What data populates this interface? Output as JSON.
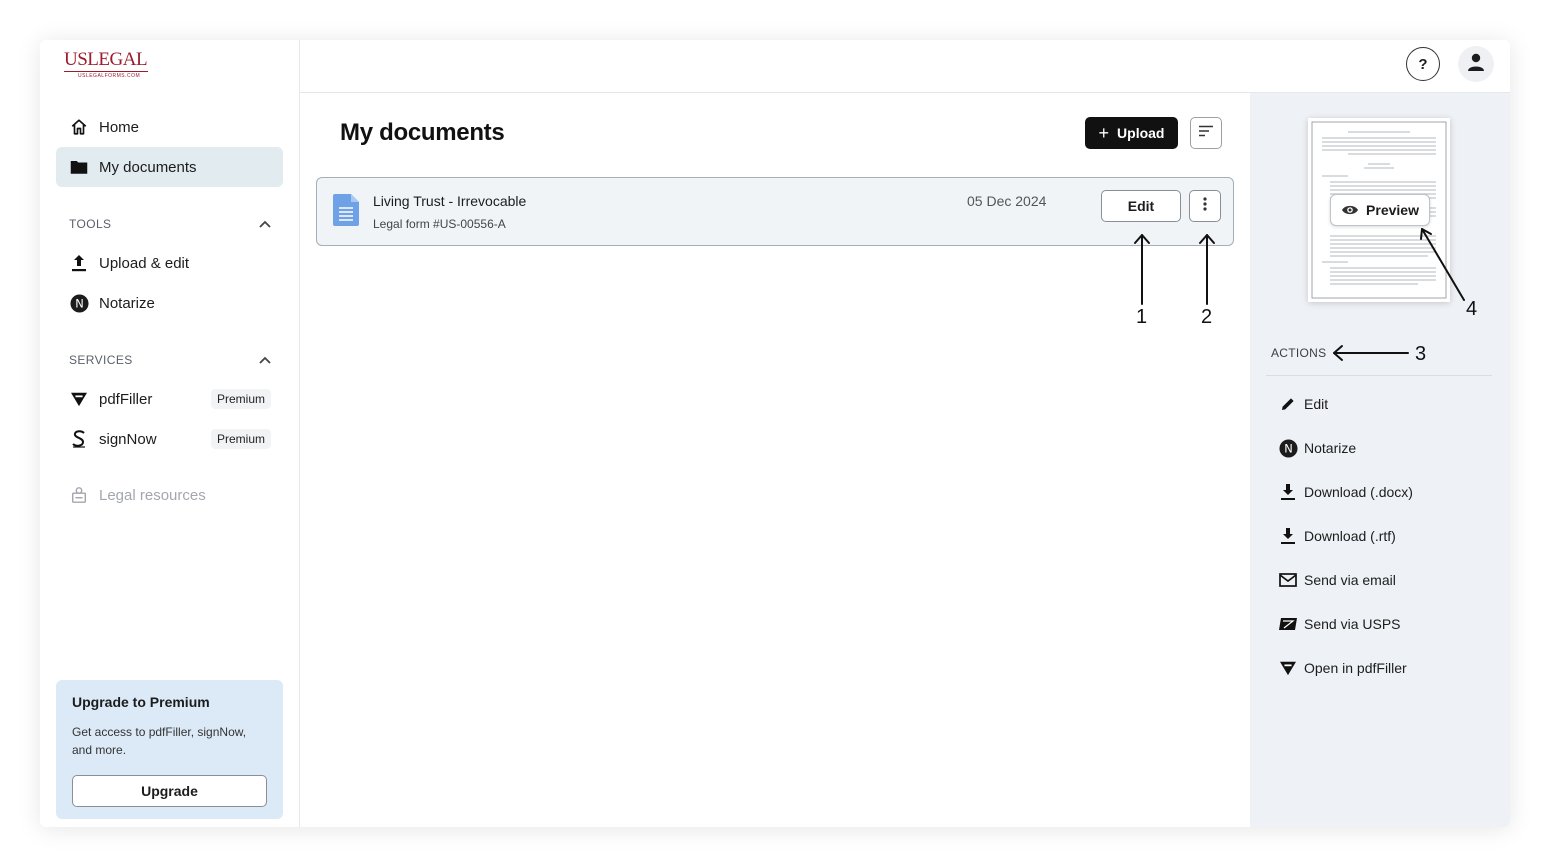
{
  "logo": {
    "text": "USLEGAL",
    "sub": "USLEGALFORMS.COM"
  },
  "sidebar": {
    "nav": [
      {
        "label": "Home",
        "icon": "home-icon"
      },
      {
        "label": "My documents",
        "icon": "folder-icon",
        "active": true
      }
    ],
    "tools": {
      "title": "TOOLS",
      "items": [
        {
          "label": "Upload & edit",
          "icon": "upload-icon"
        },
        {
          "label": "Notarize",
          "icon": "notarize-icon"
        }
      ]
    },
    "services": {
      "title": "SERVICES",
      "items": [
        {
          "label": "pdfFiller",
          "badge": "Premium",
          "icon": "pdffiller-icon"
        },
        {
          "label": "signNow",
          "badge": "Premium",
          "icon": "signnow-icon"
        }
      ]
    },
    "legal_resources": "Legal resources",
    "upgrade": {
      "title": "Upgrade to Premium",
      "text": "Get access to pdfFiller, signNow, and more.",
      "button": "Upgrade"
    }
  },
  "topbar": {
    "help": "?"
  },
  "main": {
    "title": "My documents",
    "upload_label": "Upload",
    "documents": [
      {
        "title": "Living Trust - Irrevocable",
        "subtitle": "Legal form #US-00556-A",
        "date": "05 Dec 2024",
        "edit_label": "Edit"
      }
    ]
  },
  "panel": {
    "preview_label": "Preview",
    "actions_label": "ACTIONS",
    "actions": [
      {
        "label": "Edit",
        "icon": "pencil-icon"
      },
      {
        "label": "Notarize",
        "icon": "notarize-icon"
      },
      {
        "label": "Download (.docx)",
        "icon": "download-icon"
      },
      {
        "label": "Download (.rtf)",
        "icon": "download-icon"
      },
      {
        "label": "Send via email",
        "icon": "mail-icon"
      },
      {
        "label": "Send via USPS",
        "icon": "usps-icon"
      },
      {
        "label": "Open in pdfFiller",
        "icon": "pdffiller-icon"
      }
    ]
  },
  "annotations": {
    "a1": "1",
    "a2": "2",
    "a3": "3",
    "a4": "4"
  },
  "colors": {
    "accent_dark": "#111111",
    "active_nav": "#e1ebf0",
    "upgrade_bg": "#dceaf8",
    "panel_bg": "#eef1f5",
    "brand": "#9b1c2b"
  }
}
